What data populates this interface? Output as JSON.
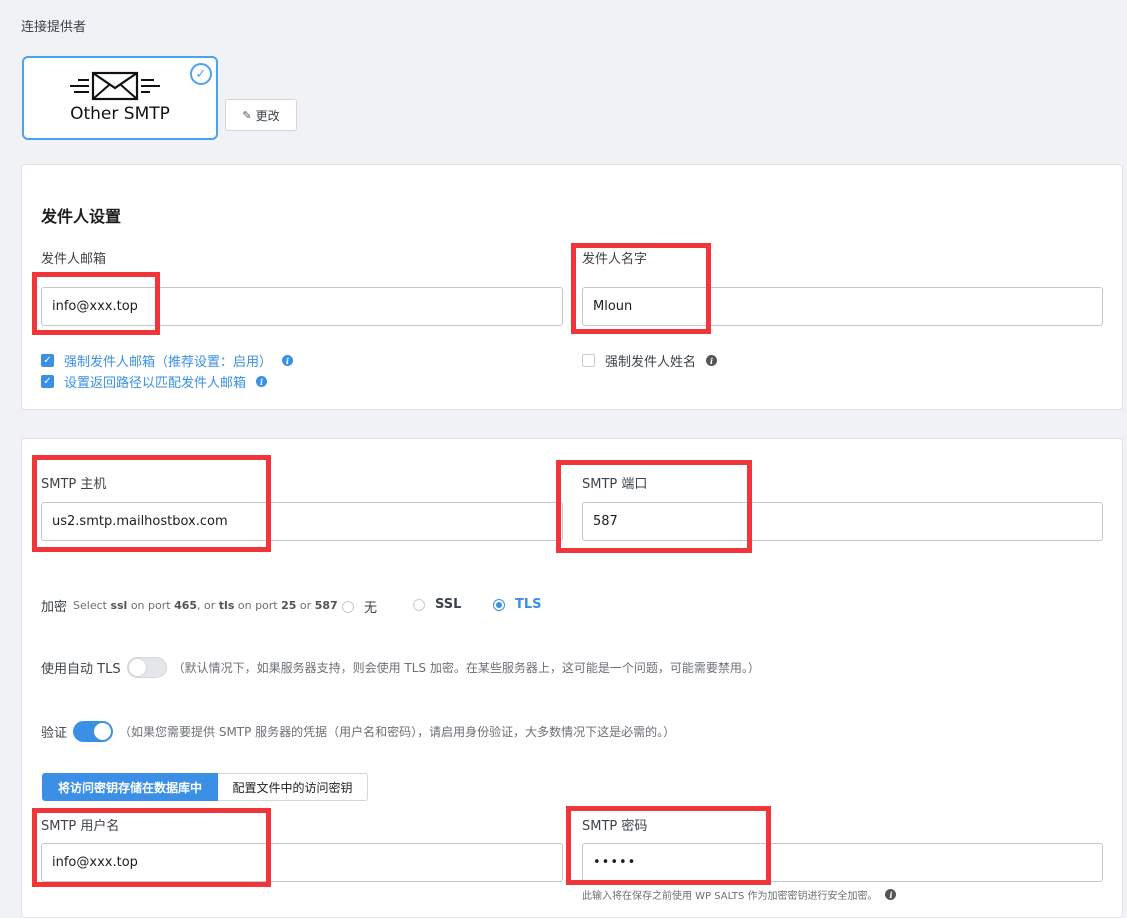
{
  "section_title": "连接提供者",
  "provider": {
    "name": "Other SMTP",
    "logo_icon": "envelope-icon",
    "selected_icon": "check-circle-icon"
  },
  "change_button": {
    "label": "更改",
    "icon": "pencil-icon"
  },
  "sender": {
    "heading": "发件人设置",
    "email_label": "发件人邮箱",
    "email_value": "info@xxx.top",
    "name_label": "发件人名字",
    "name_value": "Mloun",
    "force_email": {
      "label": "强制发件人邮箱（推荐设置：启用）",
      "checked": true
    },
    "return_path": {
      "label": "设置返回路径以匹配发件人邮箱",
      "checked": true
    },
    "force_name": {
      "label": "强制发件人姓名",
      "checked": false
    }
  },
  "smtp": {
    "host_label": "SMTP 主机",
    "host_value": "us2.smtp.mailhostbox.com",
    "port_label": "SMTP 端口",
    "port_value": "587",
    "encryption": {
      "label": "加密",
      "hint_parts": [
        "Select ",
        "ssl",
        " on port ",
        "465",
        ", or ",
        "tls",
        " on port ",
        "25",
        " or ",
        "587"
      ],
      "options": [
        "无",
        "SSL",
        "TLS"
      ],
      "selected": "TLS"
    },
    "auto_tls": {
      "label": "使用自动 TLS",
      "enabled": false,
      "note": "（默认情况下，如果服务器支持，则会使用 TLS 加密。在某些服务器上，这可能是一个问题，可能需要禁用。）"
    },
    "auth": {
      "label": "验证",
      "enabled": true,
      "note": "（如果您需要提供 SMTP 服务器的凭据（用户名和密码），请启用身份验证，大多数情况下这是必需的。）"
    },
    "key_tabs": [
      "将访问密钥存储在数据库中",
      "配置文件中的访问密钥"
    ],
    "active_tab": "将访问密钥存储在数据库中",
    "username_label": "SMTP 用户名",
    "username_value": "info@xxx.top",
    "password_label": "SMTP 密码",
    "password_value": "•••••",
    "password_help": "此输入将在保存之前使用 WP SALTS 作为加密密钥进行安全加密。"
  },
  "highlight_color": "#f0353b",
  "accent_color": "#3b8fe5"
}
